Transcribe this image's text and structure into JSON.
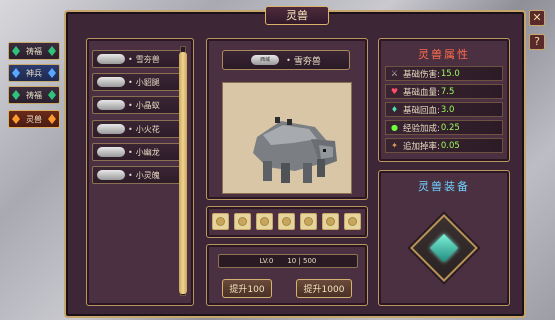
{
  "side_tabs": [
    {
      "label": "祷福",
      "style": "green"
    },
    {
      "label": "神兵",
      "style": "blue"
    },
    {
      "label": "祷福",
      "style": "green"
    },
    {
      "label": "灵兽",
      "style": "red"
    }
  ],
  "window": {
    "title": "灵兽",
    "close_label": "✕",
    "help_label": "?"
  },
  "beast_list": [
    {
      "tag": "",
      "name": "雪夯兽"
    },
    {
      "tag": "",
      "name": "小貂腿"
    },
    {
      "tag": "",
      "name": "小晶蚁"
    },
    {
      "tag": "",
      "name": "小火花"
    },
    {
      "tag": "",
      "name": "小幽龙"
    },
    {
      "tag": "",
      "name": "小灵魄"
    }
  ],
  "selected": {
    "tag": "西域",
    "name": "雪夯兽"
  },
  "level": {
    "label": "LV.0",
    "progress": "10 | 500"
  },
  "buttons": {
    "upgrade_100": "提升100",
    "upgrade_1000": "提升1000"
  },
  "attributes": {
    "title": "灵兽属性",
    "rows": [
      {
        "icon": "sword-icon",
        "label": "基础伤害:",
        "value": "15.0",
        "color": "#bfbfbf"
      },
      {
        "icon": "heart-icon",
        "label": "基础血量:",
        "value": "7.5",
        "color": "#ff4d6a"
      },
      {
        "icon": "regen-icon",
        "label": "基础回血:",
        "value": "3.0",
        "color": "#4de0b0"
      },
      {
        "icon": "exp-orb-icon",
        "label": "经验加成:",
        "value": "0.25",
        "color": "#6cff3a"
      },
      {
        "icon": "drop-icon",
        "label": "追加掉率:",
        "value": "0.05",
        "color": "#d9a060"
      }
    ]
  },
  "equipment": {
    "title": "灵兽装备"
  }
}
